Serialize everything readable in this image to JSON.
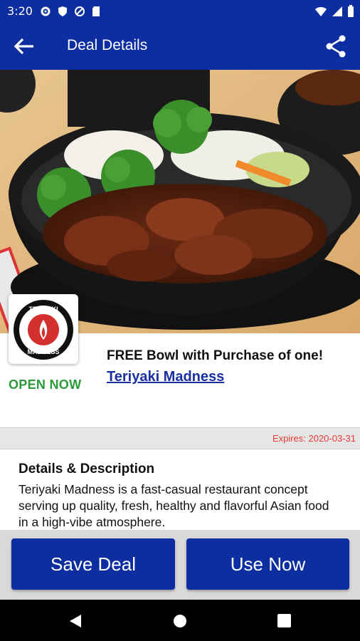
{
  "status": {
    "time": "3:20"
  },
  "appbar": {
    "title": "Deal Details"
  },
  "logo": {
    "text": "TERIYAKI MADNESS"
  },
  "deal": {
    "open_status": "OPEN NOW",
    "title": "FREE Bowl with Purchase of one!",
    "merchant": "Teriyaki Madness",
    "expires": "Expires: 2020-03-31"
  },
  "details": {
    "heading": "Details & Description",
    "body": "Teriyaki Madness is a fast-casual restaurant concept serving up quality, fresh, healthy and flavorful Asian food in a high-vibe atmosphere."
  },
  "buttons": {
    "save": "Save Deal",
    "use": "Use Now"
  },
  "colors": {
    "primary": "#0d2ea0",
    "open": "#2c9a3a",
    "expires": "#e53935"
  }
}
